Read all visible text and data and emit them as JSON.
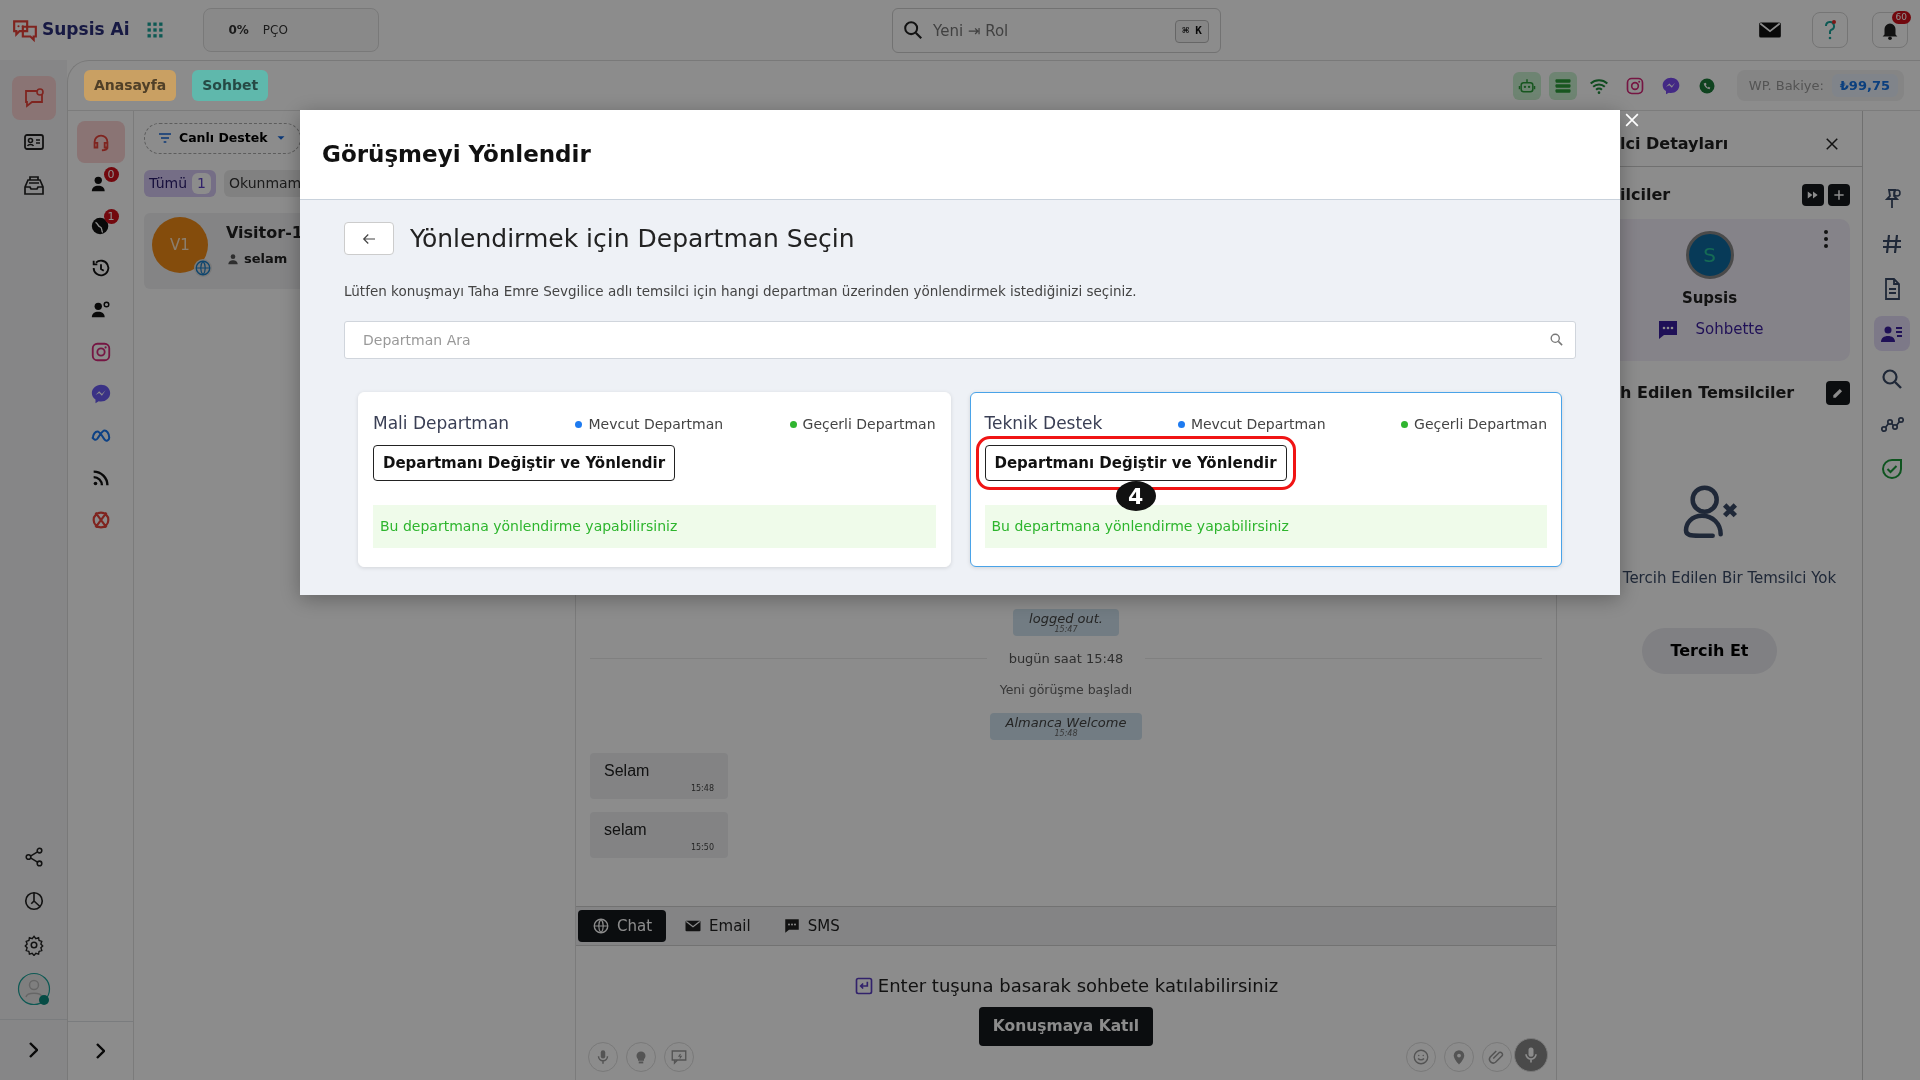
{
  "topbar": {
    "brand": "Supsis Ai",
    "progress": {
      "percent": "0%",
      "label": "PÇO"
    },
    "search": {
      "placeholder": "Yeni ⇥ Rol",
      "shortcut": "⌘ K"
    },
    "notification_count": "60"
  },
  "main_rail": [
    {
      "selected": true
    },
    {
      "selected": false
    },
    {
      "selected": false
    }
  ],
  "breadcrumbs": [
    {
      "label": "Anasayfa",
      "color": "#c9a063"
    },
    {
      "label": "Sohbet",
      "color": "#5fb8ac"
    }
  ],
  "balance": {
    "label": "WP. Bakiye:",
    "amount": "₺99,75"
  },
  "channel_rail": [
    {
      "selected": true
    },
    {
      "selected": false,
      "badge": "0"
    },
    {
      "selected": false,
      "badge": "1"
    },
    {
      "selected": false
    },
    {
      "selected": false
    },
    {
      "selected": false
    },
    {
      "selected": false
    },
    {
      "selected": false
    },
    {
      "selected": false
    },
    {
      "selected": false
    }
  ],
  "conversation_list": {
    "filter": "Canlı Destek",
    "tabs": [
      {
        "label": "Tümü",
        "count": "1",
        "selected": true
      },
      {
        "label": "Okunmam",
        "selected": false
      }
    ],
    "conversations": [
      {
        "initials": "V1",
        "name": "Visitor-1",
        "preview": "selam"
      }
    ]
  },
  "chat": {
    "messages": [
      {
        "kind": "system",
        "text": "logged out.",
        "time": "15:47"
      },
      {
        "kind": "divider",
        "text": "bugün saat 15:48"
      },
      {
        "kind": "notice",
        "text": "Yeni görüşme başladı"
      },
      {
        "kind": "system",
        "text": "Almanca Welcome",
        "time": "15:48"
      },
      {
        "kind": "incoming",
        "text": "Selam",
        "time": "15:48"
      },
      {
        "kind": "incoming",
        "text": "selam",
        "time": "15:50"
      }
    ],
    "channels": [
      {
        "label": "Chat",
        "selected": true
      },
      {
        "label": "Email",
        "selected": false
      },
      {
        "label": "SMS",
        "selected": false
      }
    ],
    "join_hint": "Enter tuşuna basarak sohbete katılabilirsiniz",
    "join_button": "Konuşmaya Katıl"
  },
  "details_panel": {
    "title": "lci Detayları",
    "agents_heading": "ilciler",
    "agent": {
      "initial": "S",
      "name": "Supsis",
      "status": "Sohbette"
    },
    "preferred_heading": "h Edilen Temsilciler",
    "empty_text": "Tercih Edilen Bir Temsilci Yok",
    "prefer_button": "Tercih Et"
  },
  "details_rail": [
    {
      "selected": false
    },
    {
      "selected": false
    },
    {
      "selected": false
    },
    {
      "selected": true
    },
    {
      "selected": false
    },
    {
      "selected": false
    },
    {
      "selected": false
    }
  ],
  "modal": {
    "title": "Görüşmeyi Yönlendir",
    "heading": "Yönlendirmek için Departman Seçin",
    "description": "Lütfen konuşmayı Taha Emre Sevgilice adlı temsilci için hangi departman üzerinden yönlendirmek istediğinizi seçiniz.",
    "search_placeholder": "Departman Ara",
    "departments": [
      {
        "name": "Mali Departman",
        "selected": false,
        "highlighted": false,
        "legend": [
          {
            "label": "Mevcut Departman",
            "color": "#1e7bf0"
          },
          {
            "label": "Geçerli Departman",
            "color": "#2fb52f"
          }
        ],
        "button": "Departmanı Değiştir ve Yönlendir",
        "message": "Bu departmana yönlendirme yapabilirsiniz"
      },
      {
        "name": "Teknik Destek",
        "selected": true,
        "highlighted": true,
        "legend": [
          {
            "label": "Mevcut Departman",
            "color": "#1e7bf0"
          },
          {
            "label": "Geçerli Departman",
            "color": "#2fb52f"
          }
        ],
        "button": "Departmanı Değiştir ve Yönlendir",
        "message": "Bu departmana yönlendirme yapabilirsiniz"
      }
    ],
    "callout": "4"
  }
}
